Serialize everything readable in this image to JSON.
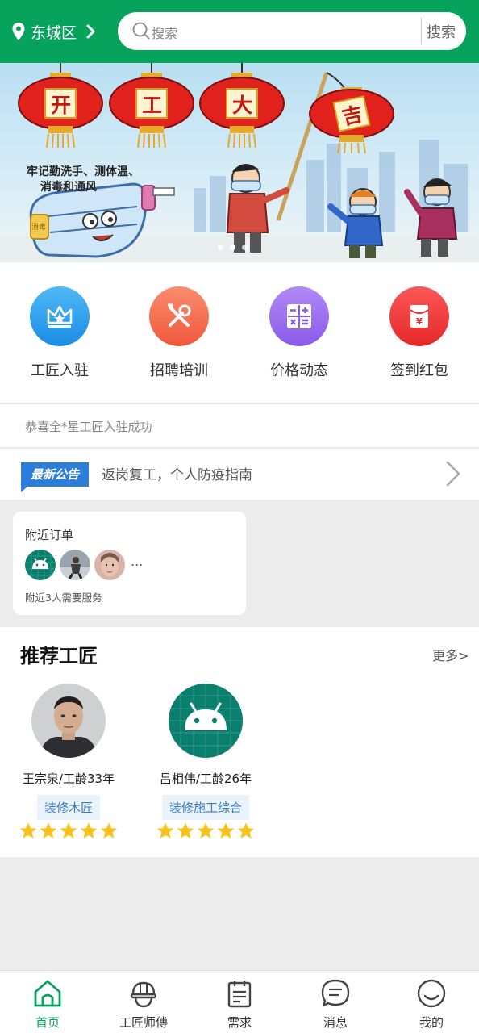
{
  "colors": {
    "brand": "#07a35d",
    "tab_active": "#07a35d",
    "star": "#f7c21b"
  },
  "header": {
    "location": "东城区",
    "search_placeholder": "搜索",
    "search_button": "搜索"
  },
  "banner": {
    "lanterns": [
      "开",
      "工",
      "大",
      "吉"
    ],
    "slogan_lines": [
      "牢记勤洗手、测体温、",
      "消毒和通风"
    ],
    "bottle_label": "消毒",
    "slide_count": 3,
    "active_slide": 1
  },
  "functions": [
    {
      "label": "工匠入驻",
      "icon": "crown-icon"
    },
    {
      "label": "招聘培训",
      "icon": "tools-icon"
    },
    {
      "label": "价格动态",
      "icon": "calculator-icon"
    },
    {
      "label": "签到红包",
      "icon": "red-envelope-icon"
    }
  ],
  "ticker": "恭喜全*星工匠入驻成功",
  "notice": {
    "badge": "最新公告",
    "text": "返岗复工，个人防疫指南"
  },
  "nearby": {
    "title": "附近订单",
    "more": "...",
    "summary": "附近3人需要服务"
  },
  "recommend": {
    "title": "推荐工匠",
    "more": "更多>",
    "workers": [
      {
        "name": "王宗泉/工龄33年",
        "tag": "装修木匠",
        "rating": 5
      },
      {
        "name": "吕相伟/工龄26年",
        "tag": "装修施工综合",
        "rating": 5
      }
    ]
  },
  "bottom_nav": [
    {
      "label": "首页",
      "icon": "home-icon",
      "active": true
    },
    {
      "label": "工匠师傅",
      "icon": "hardhat-icon",
      "active": false
    },
    {
      "label": "需求",
      "icon": "notepad-icon",
      "active": false
    },
    {
      "label": "消息",
      "icon": "chat-icon",
      "active": false
    },
    {
      "label": "我的",
      "icon": "smiley-icon",
      "active": false
    }
  ]
}
